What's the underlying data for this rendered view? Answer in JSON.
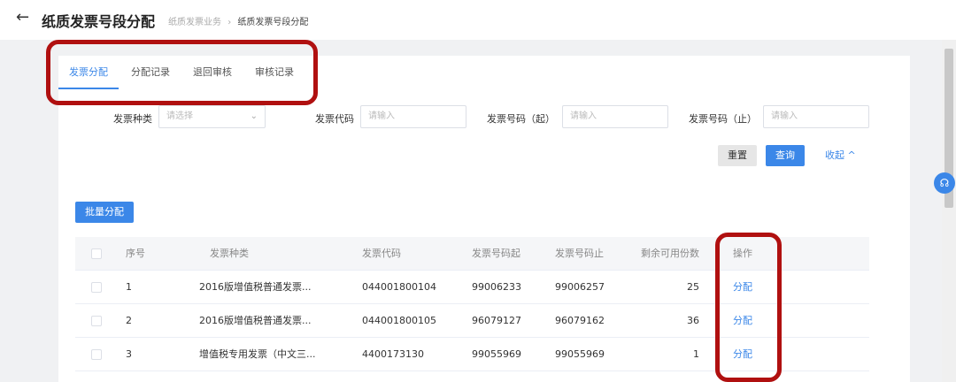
{
  "header": {
    "title": "纸质发票号段分配",
    "breadcrumb": [
      "纸质发票业务",
      "纸质发票号段分配"
    ],
    "breadcrumb_sep": "›"
  },
  "tabs": [
    {
      "label": "发票分配",
      "active": true
    },
    {
      "label": "分配记录"
    },
    {
      "label": "退回审核"
    },
    {
      "label": "审核记录"
    }
  ],
  "filters": {
    "type": {
      "label": "发票种类",
      "placeholder": "请选择"
    },
    "code": {
      "label": "发票代码",
      "placeholder": "请输入"
    },
    "start": {
      "label": "发票号码（起）",
      "placeholder": "请输入"
    },
    "end": {
      "label": "发票号码（止）",
      "placeholder": "请输入"
    }
  },
  "actions": {
    "reset": "重置",
    "query": "查询",
    "collapse": "收起"
  },
  "batch_label": "批量分配",
  "table": {
    "columns": [
      "序号",
      "发票种类",
      "发票代码",
      "发票号码起",
      "发票号码止",
      "剩余可用份数",
      "操作"
    ],
    "rows": [
      {
        "no": "1",
        "type": "2016版增值税普通发票...",
        "code": "044001800104",
        "start": "99006233",
        "end": "99006257",
        "remaining": "25",
        "action": "分配"
      },
      {
        "no": "2",
        "type": "2016版增值税普通发票...",
        "code": "044001800105",
        "start": "96079127",
        "end": "96079162",
        "remaining": "36",
        "action": "分配"
      },
      {
        "no": "3",
        "type": "增值税专用发票（中文三...",
        "code": "4400173130",
        "start": "99055969",
        "end": "99055969",
        "remaining": "1",
        "action": "分配"
      }
    ]
  },
  "colors": {
    "accent": "#3b87e8",
    "annotation": "#b01010"
  }
}
